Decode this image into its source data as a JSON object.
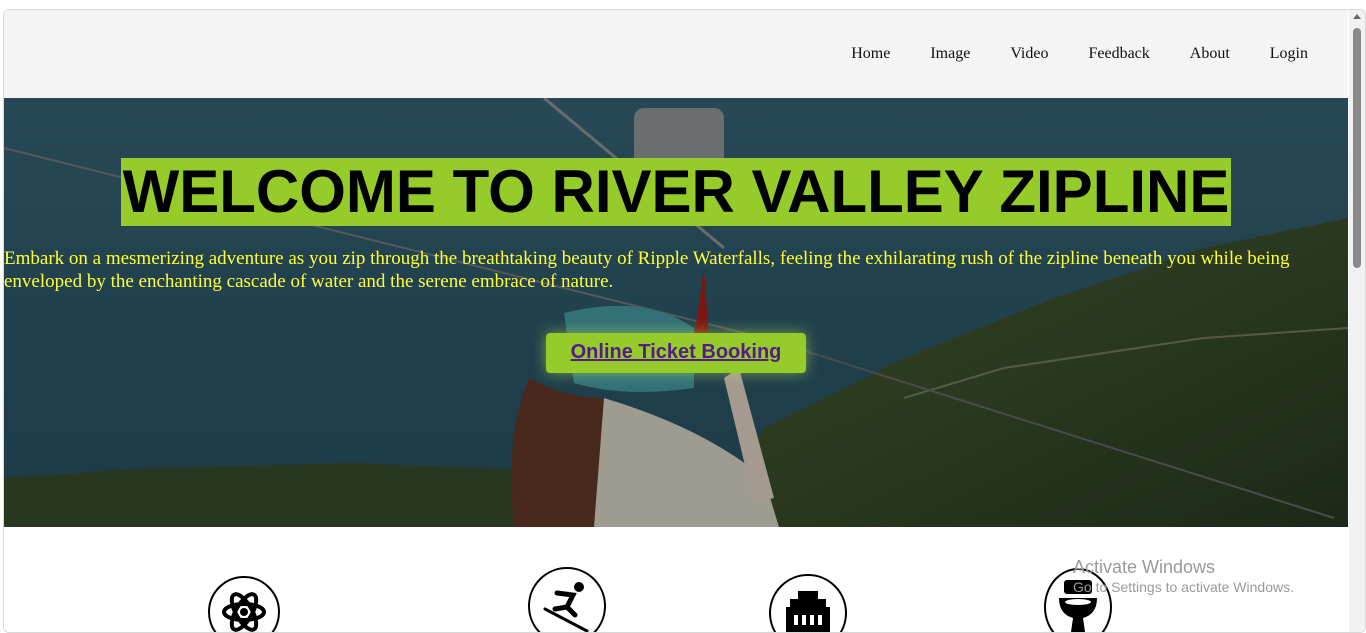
{
  "nav": {
    "links": [
      "Home",
      "Image",
      "Video",
      "Feedback",
      "About",
      "Login"
    ]
  },
  "hero": {
    "title": "WELCOME TO RIVER VALLEY ZIPLINE",
    "description": "Embark on a mesmerizing adventure as you zip through the breathtaking beauty of Ripple Waterfalls, feeling the exhilarating rush of the zipline beneath you while being enveloped by the enchanting cascade of water and the serene embrace of nature.",
    "cta_label": "Online Ticket Booking"
  },
  "features": {
    "icons": [
      "atom-icon",
      "skier-icon",
      "building-icon",
      "toilet-icon"
    ]
  },
  "watermark": {
    "title": "Activate Windows",
    "subtitle": "Go to Settings to activate Windows."
  },
  "colors": {
    "accent": "#95cc2a",
    "hero_text": "#ffff33",
    "link": "#551a8b"
  }
}
